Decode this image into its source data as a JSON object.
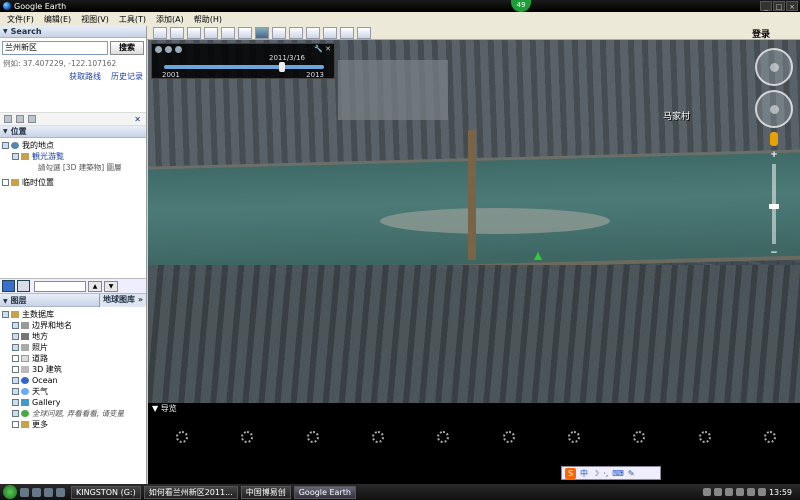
{
  "window": {
    "title": "Google Earth",
    "notification_count": "49"
  },
  "menu": [
    "文件(F)",
    "编辑(E)",
    "视图(V)",
    "工具(T)",
    "添加(A)",
    "帮助(H)"
  ],
  "search": {
    "header": "Search",
    "query": "兰州新区",
    "button": "搜索",
    "example": "例如: 37.407229, -122.107162",
    "link_directions": "获取路线",
    "link_history": "历史记录"
  },
  "places": {
    "header": "位置",
    "my_places": "我的地点",
    "sightseeing": "観光游覧",
    "sightseeing_note": "請勾選 [3D 建築物] 圖層",
    "temporary": "临时位置"
  },
  "layers": {
    "header": "图层",
    "gallery_button": "地球图库 »",
    "items": [
      "主数据库",
      "边界和地名",
      "地方",
      "照片",
      "道路",
      "3D 建筑",
      "Ocean",
      "天气",
      "Gallery",
      "全球问题, 弄看看看, 请变量",
      "更多"
    ]
  },
  "toolbar": {
    "login": "登录"
  },
  "timeslider": {
    "date": "2011/3/16",
    "from": "2001",
    "to": "2013"
  },
  "map": {
    "place_label": "马家村"
  },
  "tour": {
    "header": "导览"
  },
  "ime": {
    "label": "中"
  },
  "taskbar": {
    "items": [
      "KINGSTON (G:)",
      "如何看兰州新区2011...",
      "中国博易创",
      "Google Earth"
    ],
    "clock": "13:59"
  }
}
